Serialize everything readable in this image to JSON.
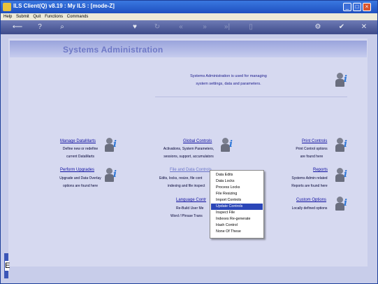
{
  "window": {
    "title": "ILS Client(Q) v8.19 :  My ILS :        [mode-Z]"
  },
  "menu": [
    "Help",
    "Submit",
    "Quit",
    "Functions",
    "Commands"
  ],
  "toolbar_icons": [
    "exit-icon",
    "help-icon",
    "search-icon",
    "heart-icon",
    "refresh-icon",
    "first-icon",
    "prev-icon",
    "next-icon",
    "last-icon",
    "new-icon",
    "settings-icon",
    "check-icon",
    "cancel-icon"
  ],
  "page": {
    "title": "Systems Administration",
    "intro_line1": "Systems Administration is used for managing",
    "intro_line2": "system settings, data and parameters."
  },
  "sections": [
    {
      "key": "manage-datamarts",
      "title": "Manage DataMarts",
      "desc1": "Define new or redefine",
      "desc2": "current DataMarts"
    },
    {
      "key": "global-controls",
      "title": "Global Controls",
      "desc1": "Activations, System Parameters,",
      "desc2": "sessions, support, accumulators"
    },
    {
      "key": "print-controls",
      "title": "Print Controls",
      "desc1": "Print Control options",
      "desc2": "are found here"
    },
    {
      "key": "perform-upgrades",
      "title": "Perform Upgrades",
      "desc1": "Upgrade and Data Overlay",
      "desc2": "options are found here"
    },
    {
      "key": "file-data-controls",
      "title": "File and Data Controls",
      "desc1": "Edits, locks, resize, file cont",
      "desc2": "indexing and file inspect"
    },
    {
      "key": "reports",
      "title": "Reports",
      "desc1": "Systems Admin related",
      "desc2": "Reports are found here"
    },
    {
      "key": "language-controls",
      "title": "Language Contr",
      "desc1": "Re-Build User Me",
      "desc2": "Word / Phrase Trans"
    },
    {
      "key": "custom-options",
      "title": "Custom Options",
      "desc1": "Locally defined options",
      "desc2": ""
    }
  ],
  "context_menu": {
    "items": [
      "Data Edits",
      "Data Locks",
      "Process Locks",
      "File Resizing",
      "Import Controls",
      "Update Controls",
      "Inspect File",
      "Indexes Re-generate",
      "Hash Control",
      "None Of These"
    ],
    "selected": "Update Controls"
  },
  "colors": {
    "accent": "#2b46b8",
    "link": "#1010a0",
    "titlebar": "#1e4fc0"
  }
}
